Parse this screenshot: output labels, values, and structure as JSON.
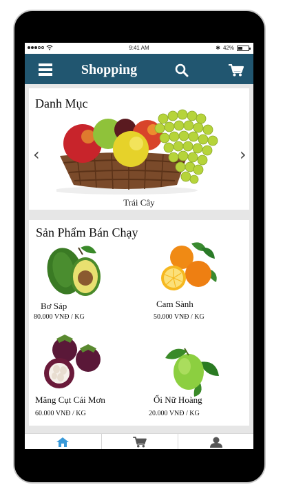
{
  "status": {
    "time": "9:41 AM",
    "battery": "42%",
    "battery_level": 0.42
  },
  "nav": {
    "title": "Shopping"
  },
  "category": {
    "heading": "Danh Mục",
    "current": "Trái Cây"
  },
  "bestsellers": {
    "heading": "Sản Phẩm Bán Chạy",
    "products": [
      {
        "name": "Bơ Sáp",
        "price": "80.000 VNĐ / KG"
      },
      {
        "name": "Cam Sành",
        "price": "50.000 VNĐ / KG"
      },
      {
        "name": "Măng Cụt Cái Mơn",
        "price": "60.000 VNĐ / KG"
      },
      {
        "name": "Ổi Nữ Hoàng",
        "price": "20.000 VNĐ / KG"
      }
    ]
  },
  "tabs": [
    {
      "name": "home",
      "active": true
    },
    {
      "name": "cart",
      "active": false
    },
    {
      "name": "profile",
      "active": false
    }
  ],
  "colors": {
    "nav_bg": "#215670",
    "active_tab": "#3a9ad9",
    "inactive_tab": "#555555"
  }
}
